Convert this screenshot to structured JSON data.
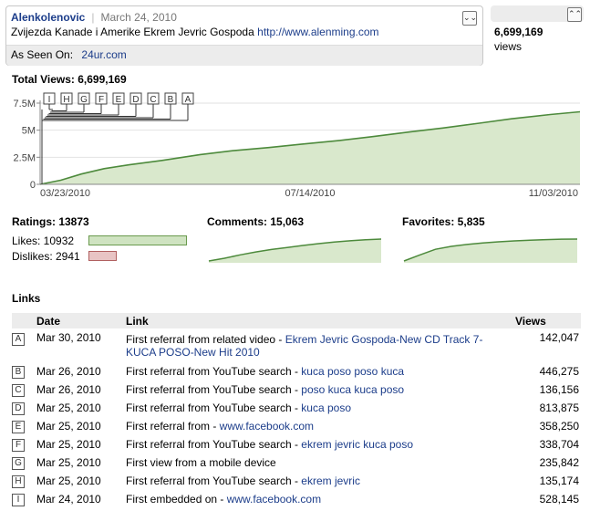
{
  "header": {
    "author": "Alenkolenovic",
    "date": "March 24, 2010",
    "title": "Zvijezda Kanade i Amerike Ekrem Jevric Gospoda",
    "url": "http://www.alenming.com",
    "as_seen_on_label": "As Seen On:",
    "as_seen_on_value": "24ur.com",
    "views_count": "6,699,169",
    "views_label": "views"
  },
  "total_views_label": "Total Views: 6,699,169",
  "chart_data": [
    {
      "type": "area",
      "title": "Total Views: 6,699,169",
      "y_ticks": [
        "7.5M",
        "5M",
        "2.5M",
        "0"
      ],
      "ylim": [
        0,
        7500000
      ],
      "x_labels": [
        "03/23/2010",
        "07/14/2010",
        "11/03/2010"
      ],
      "x_range": [
        "2010-03-23",
        "2010-11-14"
      ],
      "markers": [
        "I",
        "H",
        "G",
        "F",
        "E",
        "D",
        "C",
        "B",
        "A"
      ],
      "x": [
        "2010-03-23",
        "2010-04-01",
        "2010-04-10",
        "2010-04-20",
        "2010-05-01",
        "2010-05-15",
        "2010-06-01",
        "2010-06-15",
        "2010-07-01",
        "2010-07-15",
        "2010-08-01",
        "2010-08-15",
        "2010-09-01",
        "2010-09-15",
        "2010-10-01",
        "2010-10-15",
        "2010-11-01",
        "2010-11-14"
      ],
      "values": [
        0,
        380000,
        950000,
        1450000,
        1800000,
        2200000,
        2750000,
        3100000,
        3400000,
        3700000,
        4050000,
        4400000,
        4850000,
        5200000,
        5650000,
        6050000,
        6450000,
        6699169
      ],
      "color": "#4d8a3c",
      "fill": "#d9e8cc"
    },
    {
      "type": "bar",
      "title": "Ratings: 13873",
      "categories": [
        "Likes: 10932",
        "Dislikes: 2941"
      ],
      "values": [
        10932,
        2941
      ]
    },
    {
      "type": "line",
      "title": "Comments: 15,063",
      "values": [
        0,
        1900,
        4200,
        6200,
        7900,
        9300,
        10700,
        11900,
        13000,
        13900,
        14600,
        15063
      ]
    },
    {
      "type": "line",
      "title": "Favorites: 5,835",
      "values": [
        0,
        1600,
        3100,
        3900,
        4400,
        4800,
        5100,
        5350,
        5550,
        5700,
        5800,
        5835
      ]
    }
  ],
  "links_title": "Links",
  "links_table": {
    "headers": [
      "Date",
      "Link",
      "Views"
    ],
    "rows": [
      {
        "marker": "A",
        "date": "Mar 30, 2010",
        "text": "First referral from related video - ",
        "link": "Ekrem Jevric Gospoda-New CD Track 7-KUCA POSO-New Hit 2010",
        "views": "142,047"
      },
      {
        "marker": "B",
        "date": "Mar 26, 2010",
        "text": "First referral from YouTube search - ",
        "link": "kuca poso poso kuca",
        "views": "446,275"
      },
      {
        "marker": "C",
        "date": "Mar 26, 2010",
        "text": "First referral from YouTube search - ",
        "link": "poso kuca kuca poso",
        "views": "136,156"
      },
      {
        "marker": "D",
        "date": "Mar 25, 2010",
        "text": "First referral from YouTube search - ",
        "link": "kuca poso",
        "views": "813,875"
      },
      {
        "marker": "E",
        "date": "Mar 25, 2010",
        "text": "First referral from - ",
        "link": "www.facebook.com",
        "views": "358,250"
      },
      {
        "marker": "F",
        "date": "Mar 25, 2010",
        "text": "First referral from YouTube search - ",
        "link": "ekrem jevric kuca poso",
        "views": "338,704"
      },
      {
        "marker": "G",
        "date": "Mar 25, 2010",
        "text": "First view from a mobile device",
        "link": "",
        "views": "235,842"
      },
      {
        "marker": "H",
        "date": "Mar 25, 2010",
        "text": "First referral from YouTube search - ",
        "link": "ekrem jevric",
        "views": "135,174"
      },
      {
        "marker": "I",
        "date": "Mar 24, 2010",
        "text": "First embedded on - ",
        "link": "www.facebook.com",
        "views": "528,145"
      }
    ]
  },
  "icons": {
    "collapse": "chevron-double-down-icon",
    "expand": "chevron-double-up-icon"
  }
}
